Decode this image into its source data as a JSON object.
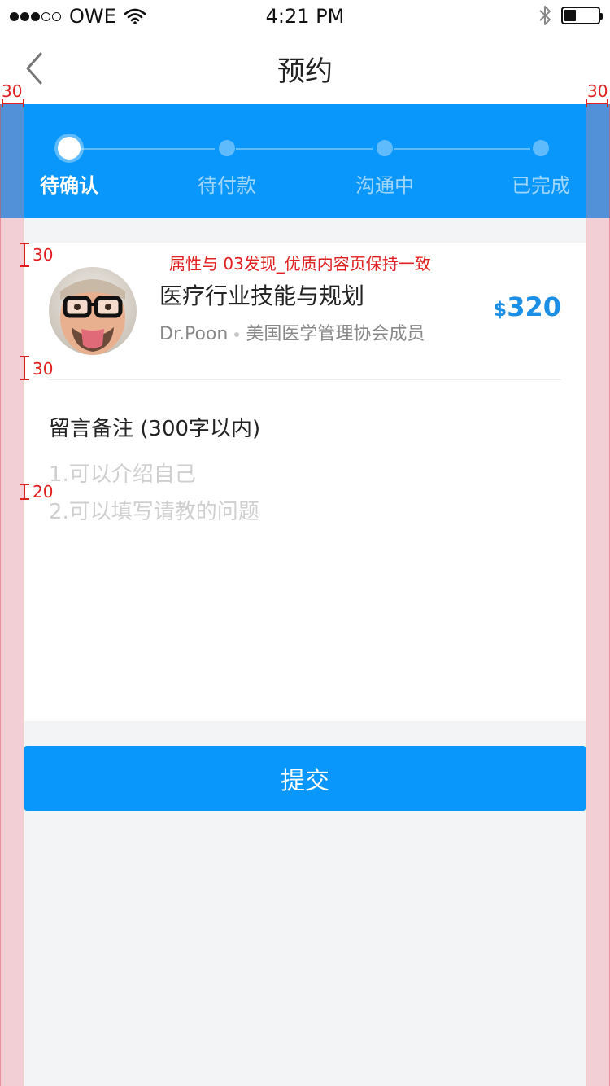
{
  "status_bar": {
    "carrier": "OWE",
    "time": "4:21 PM",
    "battery_level": 0.35,
    "signal_bars": 3,
    "signal_total": 5,
    "icons": [
      "signal-dots",
      "wifi-icon",
      "bluetooth-icon",
      "battery-icon"
    ]
  },
  "nav": {
    "title": "预约",
    "back_icon": "chevron-left-icon"
  },
  "progress": {
    "current_step": 0,
    "accent_color": "#0a97fb",
    "steps": [
      {
        "label": "待确认"
      },
      {
        "label": "待付款"
      },
      {
        "label": "沟通中"
      },
      {
        "label": "已完成"
      }
    ]
  },
  "service": {
    "title": "医疗行业技能与规划",
    "expert": "Dr.Poon",
    "expert_title": "美国医学管理协会成员",
    "currency": "$",
    "price": "320",
    "price_color": "#1b8fe6"
  },
  "memo": {
    "title": "留言备注 (300字以内)",
    "placeholder": "1.可以介绍自己\n2.可以填写请教的问题"
  },
  "submit": {
    "label": "提交"
  },
  "annotations": {
    "margin_left": "30",
    "margin_right": "30",
    "card_top_gap": "30",
    "divider_gap": "30",
    "line_gap": "20",
    "note": "属性与 03发现_优质内容页保持一致"
  }
}
